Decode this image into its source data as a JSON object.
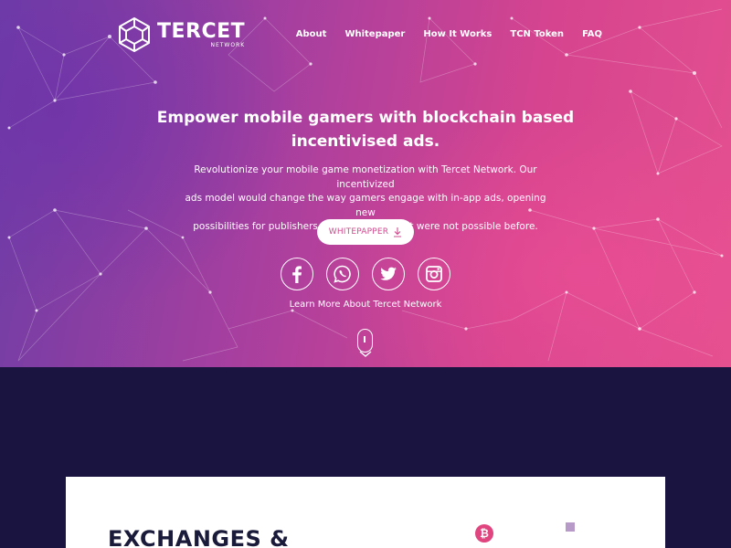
{
  "brand": {
    "name": "TERCET",
    "sub": "NETWORK"
  },
  "nav": [
    {
      "label": "About"
    },
    {
      "label": "Whitepaper"
    },
    {
      "label": "How It Works"
    },
    {
      "label": "TCN Token"
    },
    {
      "label": "FAQ"
    }
  ],
  "hero": {
    "headline_line1": "Empower mobile gamers with blockchain based",
    "headline_line2": "incentivised ads.",
    "lead_line1": "Revolutionize your mobile game monetization with Tercet Network. Our incentivized",
    "lead_line2": "ads model would change the way gamers engage with in-app ads, opening new",
    "lead_line3": "possibilities for publishers and marketers that were not possible before.",
    "button_label": "WHITEPAPPER",
    "learn_more": "Learn More About Tercet Network"
  },
  "socials": [
    {
      "icon": "facebook-icon"
    },
    {
      "icon": "whatsapp-icon"
    },
    {
      "icon": "twitter-icon"
    },
    {
      "icon": "instagram-icon"
    }
  ],
  "exchanges": {
    "title": "EXCHANGES &",
    "icon_symbol": "₿"
  },
  "colors": {
    "navy": "#1a1540",
    "pink": "#d6448f",
    "purple": "#6c3ea6",
    "button_text": "#d04a8e"
  }
}
